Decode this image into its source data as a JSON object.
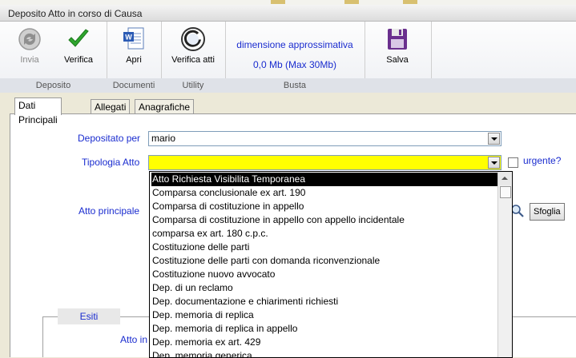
{
  "window": {
    "title": "Deposito Atto in corso di Causa"
  },
  "ribbon": {
    "groups": [
      {
        "label": "Deposito",
        "buttons": [
          {
            "label": "Invia",
            "icon": "send-disabled-icon"
          },
          {
            "label": "Verifica",
            "icon": "checkmark-icon"
          }
        ]
      },
      {
        "label": "Documenti",
        "buttons": [
          {
            "label": "Apri",
            "icon": "word-document-icon"
          }
        ]
      },
      {
        "label": "Utility",
        "buttons": [
          {
            "label": "Verifica atti",
            "icon": "giustizia-logo-icon"
          }
        ]
      },
      {
        "label": "Busta",
        "line1": "dimensione approssimativa",
        "line2": "0,0 Mb (Max 30Mb)"
      },
      {
        "label": "",
        "buttons": [
          {
            "label": "Salva",
            "icon": "floppy-disk-icon"
          }
        ]
      }
    ]
  },
  "tabs": [
    {
      "label": "Dati Principali"
    },
    {
      "label": "Allegati"
    },
    {
      "label": "Anagrafiche"
    }
  ],
  "form": {
    "depositato_per": {
      "label": "Depositato per",
      "value": "mario"
    },
    "tipologia_atto": {
      "label": "Tipologia Atto",
      "value": ""
    },
    "urgente": {
      "label": "urgente?"
    },
    "atto_principale": {
      "label": "Atto principale"
    },
    "sfoglia": {
      "label": "Sfoglia"
    },
    "esiti": {
      "label": "Esiti"
    },
    "atto_in": {
      "label": "Atto in"
    }
  },
  "dropdown": {
    "items": [
      "Atto Richiesta Visibilita Temporanea",
      "Comparsa conclusionale ex art. 190",
      "Comparsa di costituzione in appello",
      "Comparsa di costituzione in appello con appello incidentale",
      "comparsa ex art. 180 c.p.c.",
      "Costituzione delle parti",
      "Costituzione delle parti con domanda riconvenzionale",
      "Costituzione nuovo avvocato",
      "Dep. di un reclamo",
      "Dep. documentazione e chiarimenti richiesti",
      "Dep. memoria di replica",
      "Dep. memoria di replica in appello",
      "Dep. memoria ex art. 429",
      "Dep. memoria generica"
    ]
  },
  "colors": {
    "accent_text": "#1a2ccf",
    "highlight_field": "#ffff00",
    "selected_item": "#000000"
  }
}
